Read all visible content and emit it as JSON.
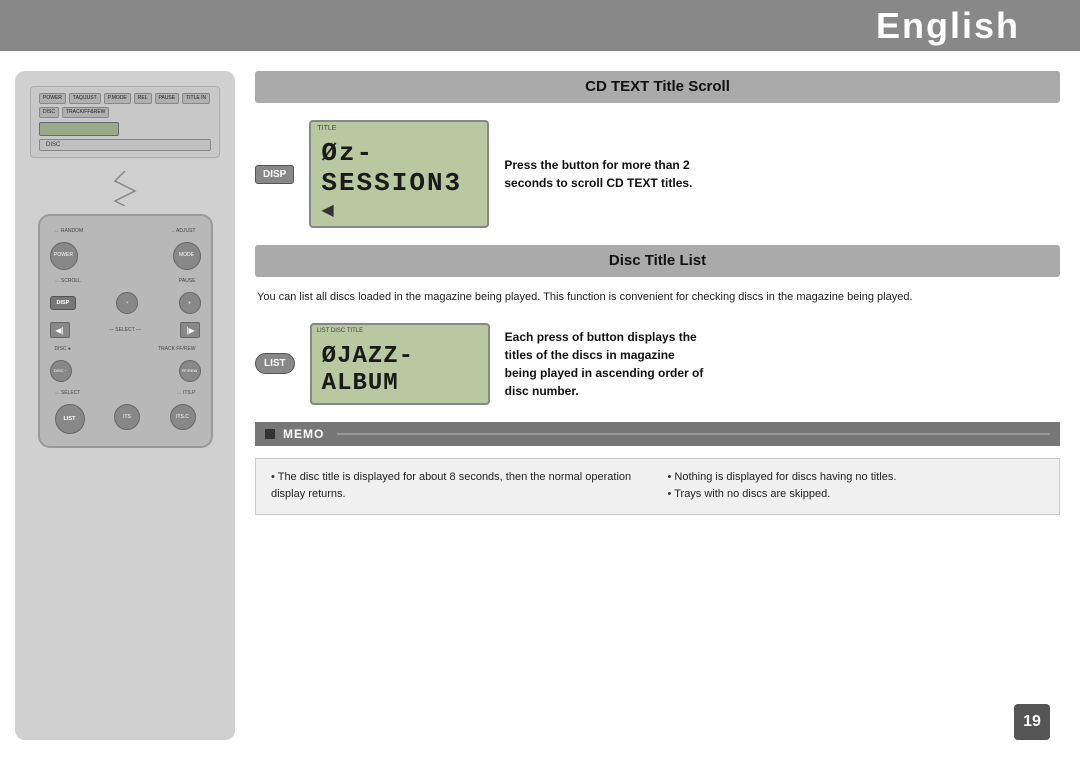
{
  "header": {
    "title": "English",
    "background": "#888888"
  },
  "page_number": "19",
  "sections": {
    "cd_text_title_scroll": {
      "header": "CD TEXT Title Scroll",
      "disp_button": "DISP",
      "lcd_label": "TITLE",
      "lcd_text": "Øz-SESSION3",
      "description_line1": "Press the button for more than 2",
      "description_line2": "seconds to scroll CD TEXT titles."
    },
    "disc_title_list": {
      "header": "Disc Title List",
      "body_text": "You can list all discs loaded in the magazine being played. This function is convenient for checking discs in the magazine being played.",
      "list_button": "LIST",
      "lcd_label": "LIST DISC TITLE",
      "lcd_text": "ØJAZZ-ALBUM",
      "description_line1": "Each press of button displays the",
      "description_line2": "titles of the discs in magazine",
      "description_line3": "being played in ascending order of",
      "description_line4": "disc number."
    },
    "memo": {
      "label": "MEMO",
      "items_left": [
        "The disc title is displayed for about 8 seconds, then the normal operation display returns."
      ],
      "items_right": [
        "Nothing is displayed for discs having no titles.",
        "Trays with no discs are skipped."
      ]
    }
  },
  "remote": {
    "top_unit": {
      "buttons": [
        "POWER",
        "TAQ/JUST",
        "P.MODE",
        "REL",
        "PAUSE",
        "TITLE IN",
        "DISC",
        "TRACK/FF&REW"
      ],
      "display_label": "DISC"
    },
    "buttons": {
      "random_label": "← RANDOM",
      "adjust_label": "→ ADJUST",
      "power_label": "POWER",
      "mode_label": "MODE",
      "scroll_label": "← SCROLL",
      "pause_label": "PAUSE",
      "disp_label": "DISP",
      "plus_label": "+",
      "pause2_label": "⏸",
      "select_left": "◀|",
      "select_right": "|▶",
      "select_label": "— SELECT —",
      "disc_label": "DISC",
      "minus_label": "−",
      "track_label": "TRACK FF/REW",
      "select2_label": "↔ SELECT",
      "itsp_label": "→ ITS.P",
      "list_label": "LIST",
      "its_label": "ITS",
      "itsc_label": "ITS.C"
    }
  }
}
